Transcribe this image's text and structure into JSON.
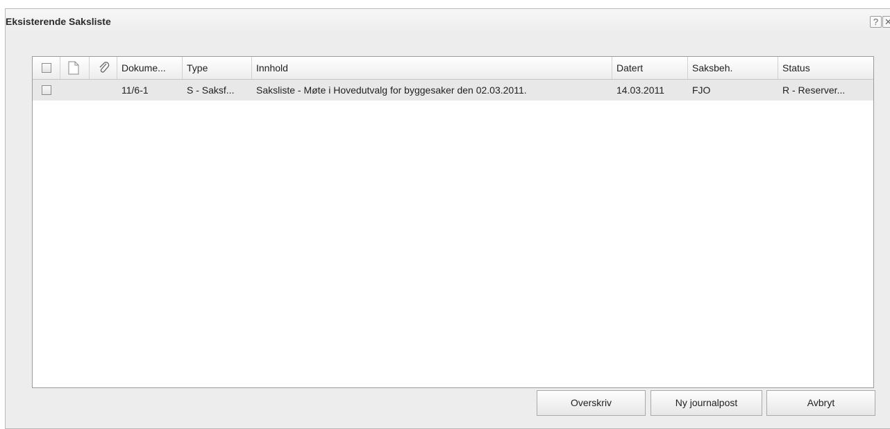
{
  "dialog": {
    "title": "Eksisterende Saksliste",
    "help_label": "?",
    "close_label": "✕"
  },
  "table": {
    "columns": [
      "",
      "",
      "",
      "Dokume...",
      "Type",
      "Innhold",
      "Datert",
      "Saksbeh.",
      "Status"
    ],
    "rows": [
      {
        "dokument": "11/6-1",
        "type": "S - Saksf...",
        "innhold": "Saksliste - Møte i Hovedutvalg for byggesaker den 02.03.2011.",
        "datert": "14.03.2011",
        "saksbeh": "FJO",
        "status": "R - Reserver..."
      }
    ]
  },
  "buttons": {
    "overwrite": "Overskriv",
    "new_journal": "Ny journalpost",
    "cancel": "Avbryt"
  },
  "icons": {
    "header_document": "document-icon",
    "header_attachment": "paperclip-icon"
  },
  "colors": {
    "dialog_bg": "#ededed",
    "selected_row": "#e8e8e8"
  }
}
